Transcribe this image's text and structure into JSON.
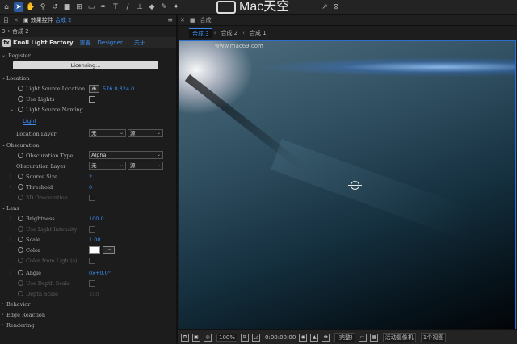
{
  "toolbar": {
    "tools": [
      "arrow",
      "hand",
      "zoom",
      "orbit",
      "camera",
      "region",
      "pen",
      "text",
      "brush",
      "stamp",
      "eraser",
      "roto",
      "puppet",
      "pin",
      "grid"
    ],
    "watermark": "Mac天空"
  },
  "left_panel": {
    "tab_partial": "目",
    "tab_label": "效果控件",
    "tab_comp": "合成 2",
    "breadcrumb": "3 • 合成 2",
    "effect": {
      "name": "Knoll Light Factory",
      "links": [
        "重置",
        "Designer...",
        "关于..."
      ]
    },
    "sections": {
      "register": "Register",
      "licensing_btn": "Licensing...",
      "location": "Location",
      "light_source_location": "Light Source Location",
      "light_source_location_value": "576.0,324.0",
      "use_lights": "Use Lights",
      "light_source_naming": "Light Source Naming",
      "light_link": "Light",
      "location_layer": "Location Layer",
      "location_layer_sel1": "无",
      "location_layer_sel2": "源",
      "obscuration": "Obscuration",
      "obscuration_type": "Obscuration Type",
      "obscuration_type_value": "Alpha",
      "obscuration_layer": "Obscuration Layer",
      "obscuration_layer_sel1": "无",
      "obscuration_layer_sel2": "源",
      "source_size": "Source Size",
      "source_size_value": "2",
      "threshold": "Threshold",
      "threshold_value": "0",
      "obscuration_3d": "3D Obscuration",
      "lens": "Lens",
      "brightness": "Brightness",
      "brightness_value": "100.0",
      "use_light_intensity": "Use Light Intensity",
      "scale": "Scale",
      "scale_value": "1.00",
      "color": "Color",
      "color_from_lights": "Color from Light(s)",
      "angle": "Angle",
      "angle_value": "0x+0.0°",
      "use_depth_scale": "Use Depth Scale",
      "depth_scale": "Depth Scale",
      "depth_scale_value": "100",
      "behavior": "Behavior",
      "edge_reaction": "Edge Reaction",
      "rendering": "Rendering"
    }
  },
  "viewer": {
    "tab_label": "合成",
    "comp_tabs": [
      "合成 3",
      "合成 2",
      "合成 1"
    ],
    "watermark_url": "www.mac69.com"
  },
  "statusbar": {
    "zoom": "100%",
    "timecode": "0:00:00:00",
    "resolution": "(完整)",
    "camera": "活动摄像机",
    "views": "1个视图"
  },
  "colors": {
    "accent": "#3b8ef0",
    "panel_bg": "#1c1c1c",
    "viewer_border": "#2d6dd0"
  }
}
